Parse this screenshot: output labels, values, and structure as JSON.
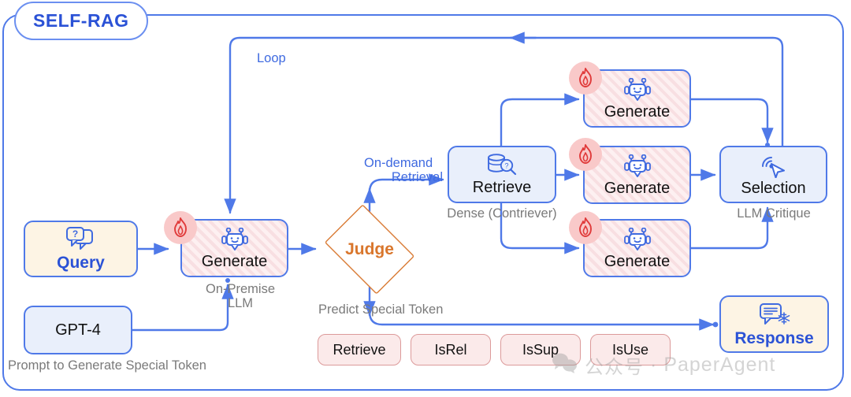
{
  "diagram": {
    "title": "SELF-RAG",
    "type": "flowchart",
    "accent_colors": {
      "blue": "#4f79e8",
      "blue_text": "#2b52d6",
      "orange": "#d9762c",
      "hatch_pink": "#f8dfe2",
      "cream": "#fdf4e4",
      "light_blue": "#e9effb",
      "pill_pink": "#fbeaea",
      "flame_badge": "#f9c9c9",
      "gray_caption": "#7a7a7a"
    }
  },
  "nodes": {
    "query": {
      "label": "Query",
      "icon": "question-chat-bubble-icon"
    },
    "gpt4": {
      "label": "GPT-4",
      "caption": "Prompt to Generate Special Token"
    },
    "generate_main": {
      "label": "Generate",
      "icon": "robot-icon",
      "badge": "flame-icon",
      "caption_line1": "On-Premise",
      "caption_line2": "LLM"
    },
    "judge": {
      "label": "Judge"
    },
    "retrieve": {
      "label": "Retrieve",
      "icon": "database-search-icon",
      "caption": "Dense (Contriever)"
    },
    "generate_top": {
      "label": "Generate",
      "icon": "robot-icon",
      "badge": "flame-icon"
    },
    "generate_mid": {
      "label": "Generate",
      "icon": "robot-icon",
      "badge": "flame-icon"
    },
    "generate_bot": {
      "label": "Generate",
      "icon": "robot-icon",
      "badge": "flame-icon"
    },
    "selection": {
      "label": "Selection",
      "icon": "cursor-click-icon",
      "caption": "LLM Critique"
    },
    "response": {
      "label": "Response",
      "icon": "chat-lines-snowflake-icon"
    }
  },
  "edge_labels": {
    "loop": "Loop",
    "on_demand_retrieval_line1": "On-demand",
    "on_demand_retrieval_line2": "Retrieval",
    "predict_special_token": "Predict Special Token"
  },
  "special_tokens": [
    {
      "label": "Retrieve"
    },
    {
      "label": "IsRel"
    },
    {
      "label": "IsSup"
    },
    {
      "label": "IsUse"
    }
  ],
  "watermark": {
    "icon": "wechat-icon",
    "cn_text": "公众号",
    "separator": "·",
    "brand": "PaperAgent"
  }
}
